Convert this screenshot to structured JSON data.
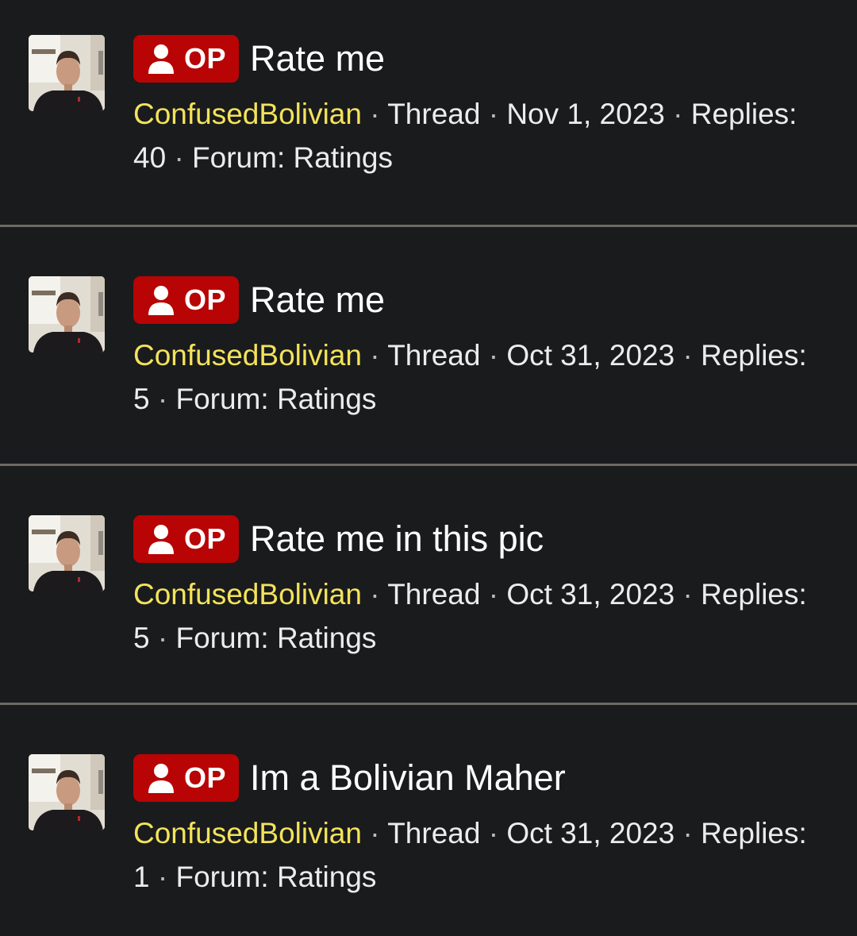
{
  "colors": {
    "background": "#1a1b1d",
    "op_badge": "#b80404",
    "author": "#f3e35b",
    "separator": "#6e6a63"
  },
  "threads": [
    {
      "badge": "OP",
      "title": "Rate me",
      "author": "ConfusedBolivian",
      "type": "Thread",
      "date": "Nov 1, 2023",
      "replies_label": "Replies:",
      "replies": "40",
      "forum_label": "Forum:",
      "forum": "Ratings",
      "avatar_icon": "user-avatar",
      "badge_icon": "person-icon"
    },
    {
      "badge": "OP",
      "title": "Rate me",
      "author": "ConfusedBolivian",
      "type": "Thread",
      "date": "Oct 31, 2023",
      "replies_label": "Replies:",
      "replies": "5",
      "forum_label": "Forum:",
      "forum": "Ratings",
      "avatar_icon": "user-avatar",
      "badge_icon": "person-icon"
    },
    {
      "badge": "OP",
      "title": "Rate me in this pic",
      "author": "ConfusedBolivian",
      "type": "Thread",
      "date": "Oct 31, 2023",
      "replies_label": "Replies:",
      "replies": "5",
      "forum_label": "Forum:",
      "forum": "Ratings",
      "avatar_icon": "user-avatar",
      "badge_icon": "person-icon"
    },
    {
      "badge": "OP",
      "title": "Im a Bolivian Maher",
      "author": "ConfusedBolivian",
      "type": "Thread",
      "date": "Oct 31, 2023",
      "replies_label": "Replies:",
      "replies": "1",
      "forum_label": "Forum:",
      "forum": "Ratings",
      "avatar_icon": "user-avatar",
      "badge_icon": "person-icon"
    }
  ]
}
